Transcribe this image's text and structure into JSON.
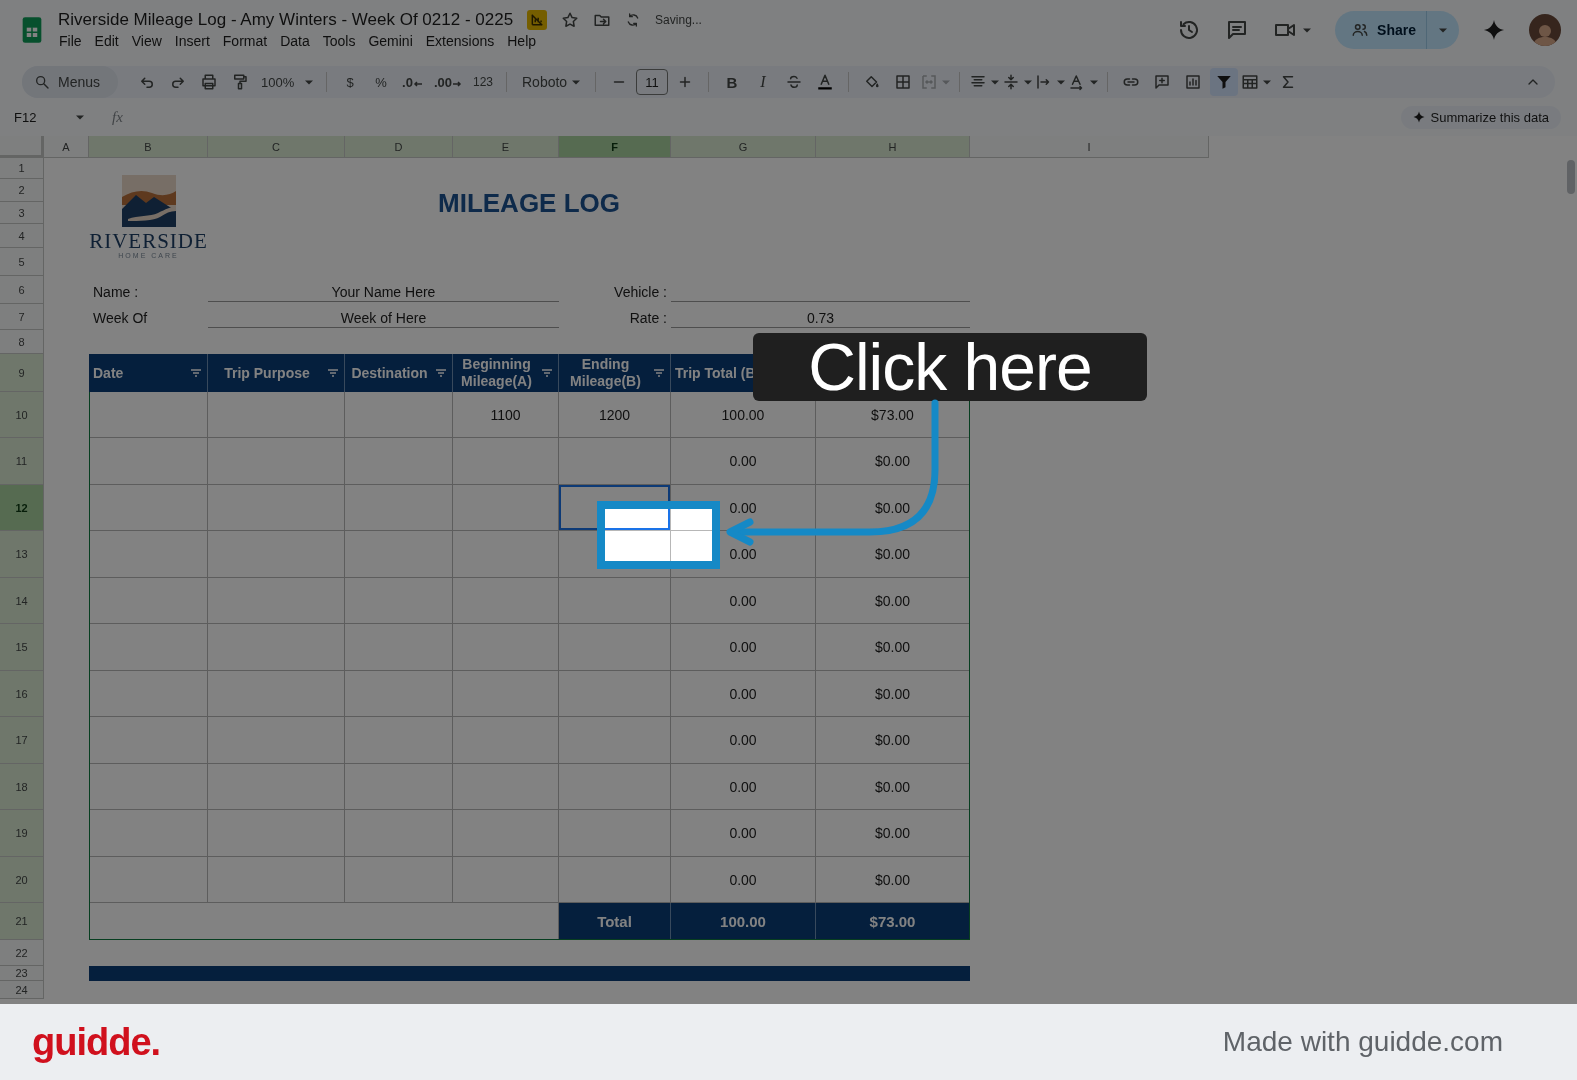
{
  "title_bar": {
    "doc_title": "Riverside Mileage Log - Amy Winters - Week Of 0212 - 0225",
    "status": "Saving...",
    "menus": [
      "File",
      "Edit",
      "View",
      "Insert",
      "Format",
      "Data",
      "Tools",
      "Gemini",
      "Extensions",
      "Help"
    ],
    "share_label": "Share"
  },
  "toolbar": {
    "search_placeholder": "Menus",
    "zoom": "100%",
    "currency": "$",
    "percent": "%",
    "decrease_decimal": ".0",
    "increase_decimal": ".00",
    "number_format": "123",
    "font": "Roboto",
    "font_size": "11",
    "bold": "B",
    "italic": "I",
    "merge_disabled": true,
    "filter_on": true
  },
  "formula_bar": {
    "name_box": "F12",
    "fx": "fx",
    "summarize": "Summarize this data"
  },
  "columns": [
    {
      "label": "A",
      "highlighted": false,
      "selected": false
    },
    {
      "label": "B",
      "highlighted": true,
      "selected": false
    },
    {
      "label": "C",
      "highlighted": true,
      "selected": false
    },
    {
      "label": "D",
      "highlighted": true,
      "selected": false
    },
    {
      "label": "E",
      "highlighted": true,
      "selected": false
    },
    {
      "label": "F",
      "highlighted": true,
      "selected": true
    },
    {
      "label": "G",
      "highlighted": true,
      "selected": false
    },
    {
      "label": "H",
      "highlighted": true,
      "selected": false
    },
    {
      "label": "I",
      "highlighted": false,
      "selected": false
    }
  ],
  "row_headers": [
    {
      "label": "1",
      "highlighted": false,
      "selected": false
    },
    {
      "label": "2",
      "highlighted": false,
      "selected": false
    },
    {
      "label": "3",
      "highlighted": false,
      "selected": false
    },
    {
      "label": "4",
      "highlighted": false,
      "selected": false
    },
    {
      "label": "5",
      "highlighted": false,
      "selected": false
    },
    {
      "label": "6",
      "highlighted": false,
      "selected": false
    },
    {
      "label": "7",
      "highlighted": false,
      "selected": false
    },
    {
      "label": "8",
      "highlighted": false,
      "selected": false
    },
    {
      "label": "9",
      "highlighted": true,
      "selected": false
    },
    {
      "label": "10",
      "highlighted": true,
      "selected": false
    },
    {
      "label": "11",
      "highlighted": true,
      "selected": false
    },
    {
      "label": "12",
      "highlighted": true,
      "selected": true
    },
    {
      "label": "13",
      "highlighted": true,
      "selected": false
    },
    {
      "label": "14",
      "highlighted": true,
      "selected": false
    },
    {
      "label": "15",
      "highlighted": true,
      "selected": false
    },
    {
      "label": "16",
      "highlighted": true,
      "selected": false
    },
    {
      "label": "17",
      "highlighted": true,
      "selected": false
    },
    {
      "label": "18",
      "highlighted": true,
      "selected": false
    },
    {
      "label": "19",
      "highlighted": true,
      "selected": false
    },
    {
      "label": "20",
      "highlighted": true,
      "selected": false
    },
    {
      "label": "21",
      "highlighted": true,
      "selected": false
    },
    {
      "label": "22",
      "highlighted": false,
      "selected": false
    },
    {
      "label": "23",
      "highlighted": false,
      "selected": false
    },
    {
      "label": "24",
      "highlighted": false,
      "selected": false
    }
  ],
  "logo": {
    "name": "RIVERSIDE",
    "tagline": "HOME CARE"
  },
  "form": {
    "title": "MILEAGE LOG",
    "name_label": "Name :",
    "name_value": "Your Name Here",
    "week_label": "Week Of",
    "week_value": "Week of Here",
    "vehicle_label": "Vehicle :",
    "rate_label": "Rate :",
    "rate_value": "0.73"
  },
  "table": {
    "headers": [
      {
        "label": "Date",
        "filter": true
      },
      {
        "label": "Trip Purpose",
        "filter": true
      },
      {
        "label": "Destination",
        "filter": true
      },
      {
        "label": "Beginning Mileage(A)",
        "filter": true
      },
      {
        "label": "Ending Mileage(B)",
        "filter": true
      },
      {
        "label": "Trip Total (B"
      }
    ],
    "rows": [
      {
        "beginning": "1100",
        "ending": "1200",
        "trip_total": "100.00",
        "expense": "$73.00",
        "ending_selected": false
      },
      {
        "trip_total": "0.00",
        "expense": "$0.00",
        "ending_selected": false
      },
      {
        "trip_total": "0.00",
        "expense": "$0.00",
        "ending_selected": true
      },
      {
        "trip_total": "0.00",
        "expense": "$0.00",
        "ending_selected": false
      },
      {
        "trip_total": "0.00",
        "expense": "$0.00",
        "ending_selected": false
      },
      {
        "trip_total": "0.00",
        "expense": "$0.00",
        "ending_selected": false
      },
      {
        "trip_total": "0.00",
        "expense": "$0.00",
        "ending_selected": false
      },
      {
        "trip_total": "0.00",
        "expense": "$0.00",
        "ending_selected": false
      },
      {
        "trip_total": "0.00",
        "expense": "$0.00",
        "ending_selected": false
      },
      {
        "trip_total": "0.00",
        "expense": "$0.00",
        "ending_selected": false
      },
      {
        "trip_total": "0.00",
        "expense": "$0.00",
        "ending_selected": false
      }
    ],
    "total_label": "Total",
    "total_trip": "100.00",
    "total_expense": "$73.00"
  },
  "callout": {
    "text": "Click here"
  },
  "footer": {
    "brand": "guidde.",
    "credit": "Made with guidde.com"
  }
}
